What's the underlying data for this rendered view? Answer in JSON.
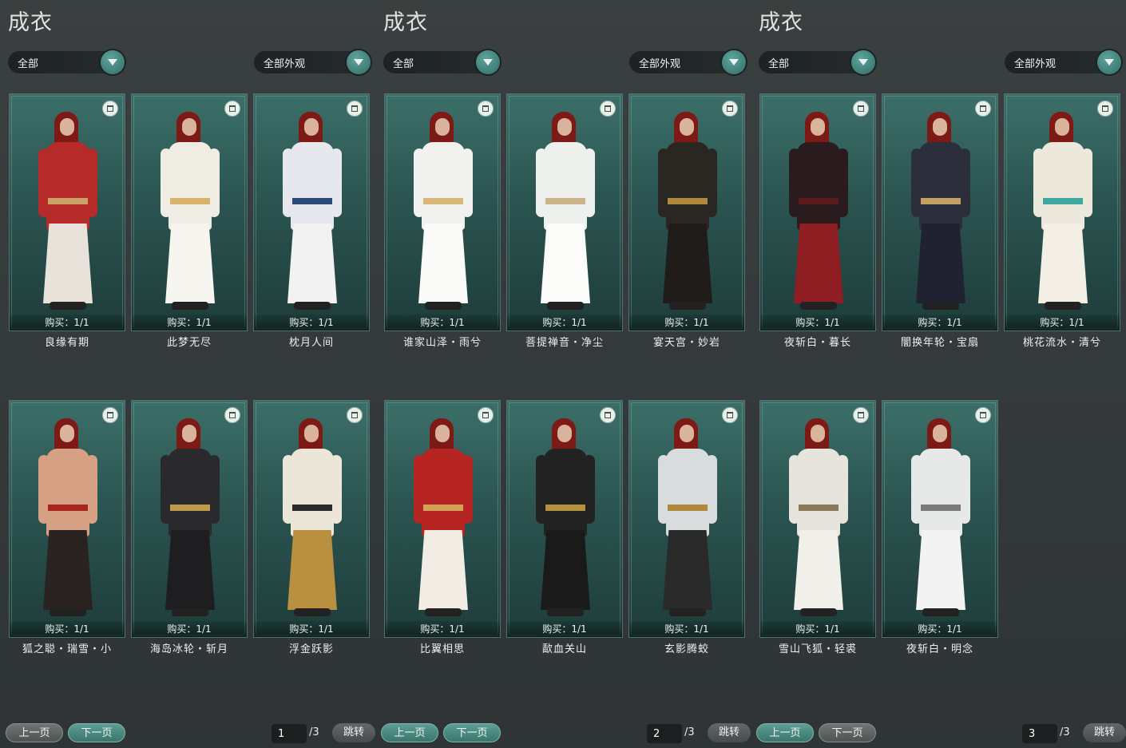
{
  "panels": [
    {
      "title": "成衣",
      "filter_left": "全部",
      "filter_right": "全部外观",
      "items": [
        {
          "name": "良缘有期",
          "purchase": "购买：1/1",
          "colors": [
            "#b62a2a",
            "#e8e2da",
            "#ffffff",
            "#caa268"
          ]
        },
        {
          "name": "此梦无尽",
          "purchase": "购买：1/1",
          "colors": [
            "#efece4",
            "#f7f5ef",
            "#ffffff",
            "#d8b36c"
          ]
        },
        {
          "name": "枕月人间",
          "purchase": "购买：1/1",
          "colors": [
            "#e6e8ee",
            "#f2f2f2",
            "#ffffff",
            "#2c4a78"
          ]
        },
        {
          "name": "狐之聪・瑞雪・小",
          "purchase": "购买：1/1",
          "colors": [
            "#d6a085",
            "#2a2322",
            "#d6a085",
            "#a6261e"
          ]
        },
        {
          "name": "海岛冰轮・斩月",
          "purchase": "购买：1/1",
          "colors": [
            "#2a2a2c",
            "#1e1e20",
            "#2a2a2c",
            "#c09a4c"
          ]
        },
        {
          "name": "浮金跃影",
          "purchase": "购买：1/1",
          "colors": [
            "#ece6d8",
            "#b99040",
            "#ece6d8",
            "#2a2a2a"
          ]
        }
      ],
      "pager": {
        "prev": "上一页",
        "next": "下一页",
        "page": "1",
        "total": "/3",
        "jump": "跳转"
      }
    },
    {
      "title": "成衣",
      "filter_left": "全部",
      "filter_right": "全部外观",
      "items": [
        {
          "name": "谁家山泽・雨兮",
          "purchase": "购买：1/1",
          "colors": [
            "#f1f1ef",
            "#fafaf8",
            "#ffffff",
            "#d8b878"
          ]
        },
        {
          "name": "菩提禅音・净尘",
          "purchase": "购买：1/1",
          "colors": [
            "#eef0ee",
            "#fbfbfa",
            "#ffffff",
            "#cbb489"
          ]
        },
        {
          "name": "宴天宫・妙岩",
          "purchase": "购买：1/1",
          "colors": [
            "#2a2622",
            "#1f1c19",
            "#2a2622",
            "#b08a3c"
          ]
        },
        {
          "name": "比翼相思",
          "purchase": "购买：1/1",
          "colors": [
            "#b62522",
            "#f2ece4",
            "#b62522",
            "#d2a356"
          ]
        },
        {
          "name": "歃血关山",
          "purchase": "购买：1/1",
          "colors": [
            "#222222",
            "#1a1a1a",
            "#222222",
            "#b3913f"
          ]
        },
        {
          "name": "玄影腾蛟",
          "purchase": "购买：1/1",
          "colors": [
            "#d9dcdc",
            "#2a2a2a",
            "#d9dcdc",
            "#b08a3c"
          ]
        }
      ],
      "pager": {
        "prev": "上一页",
        "next": "下一页",
        "page": "2",
        "total": "/3",
        "jump": "跳转"
      }
    },
    {
      "title": "成衣",
      "filter_left": "全部",
      "filter_right": "全部外观",
      "items": [
        {
          "name": "夜斩白・暮长",
          "purchase": "购买：1/1",
          "colors": [
            "#2a1c1e",
            "#8e1e22",
            "#1f1f22",
            "#5a1a1c"
          ]
        },
        {
          "name": "闇换年轮・宝扇",
          "purchase": "购买：1/1",
          "colors": [
            "#2c2e3c",
            "#202231",
            "#2c2e3c",
            "#c2a064"
          ]
        },
        {
          "name": "桃花流水・清兮",
          "purchase": "购买：1/1",
          "colors": [
            "#ece8dc",
            "#f3efe5",
            "#ece8dc",
            "#3fa99f"
          ]
        },
        {
          "name": "雪山飞狐・轻裘",
          "purchase": "购买：1/1",
          "colors": [
            "#e6e4dc",
            "#f1efea",
            "#e6e4dc",
            "#8a7a5a"
          ]
        },
        {
          "name": "夜斩白・明念",
          "purchase": "购买：1/1",
          "colors": [
            "#e7e8e8",
            "#f3f3f3",
            "#1e1e1e",
            "#7a7a7a"
          ]
        }
      ],
      "pager": {
        "prev": "上一页",
        "next": "下一页",
        "page": "3",
        "total": "/3",
        "jump": "跳转"
      }
    }
  ]
}
